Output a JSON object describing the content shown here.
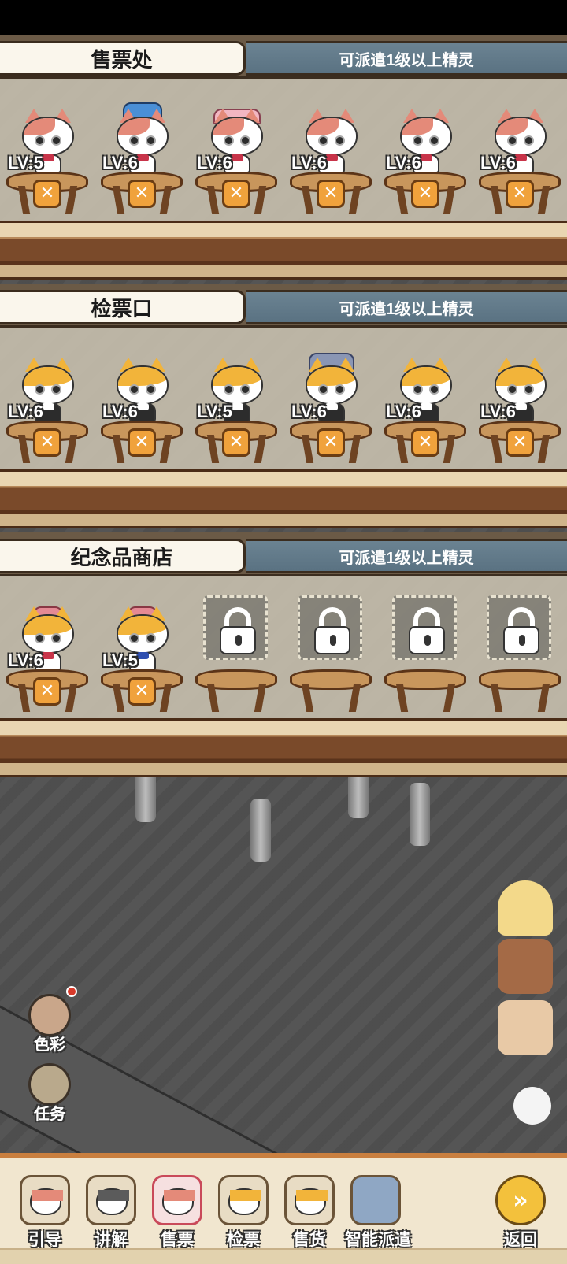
{
  "panels": [
    {
      "title": "售票处",
      "hint": "可派遣1级以上精灵",
      "slots": [
        {
          "level": "LV:5",
          "style": "calico"
        },
        {
          "level": "LV:6",
          "style": "calico"
        },
        {
          "level": "LV:6",
          "style": "calico"
        },
        {
          "level": "LV:6",
          "style": "calico"
        },
        {
          "level": "LV:6",
          "style": "calico"
        },
        {
          "level": "LV:6",
          "style": "calico"
        }
      ]
    },
    {
      "title": "检票口",
      "hint": "可派遣1级以上精灵",
      "slots": [
        {
          "level": "LV:6",
          "style": "yellow"
        },
        {
          "level": "LV:6",
          "style": "yellow"
        },
        {
          "level": "LV:5",
          "style": "yellow"
        },
        {
          "level": "LV:6",
          "style": "yellow"
        },
        {
          "level": "LV:6",
          "style": "yellow"
        },
        {
          "level": "LV:6",
          "style": "yellow"
        }
      ]
    },
    {
      "title": "纪念品商店",
      "hint": "可派遣1级以上精灵",
      "slots": [
        {
          "level": "LV:6",
          "style": "yellow"
        },
        {
          "level": "LV:5",
          "style": "yellow"
        },
        {
          "locked": true
        },
        {
          "locked": true
        },
        {
          "locked": true
        },
        {
          "locked": true
        }
      ]
    }
  ],
  "remove_glyph": "✕",
  "side_buttons": [
    {
      "label": "色彩",
      "icon": "palette-icon"
    },
    {
      "label": "任务",
      "icon": "quest-icon"
    }
  ],
  "bottom_nav": [
    {
      "label": "引导",
      "icon": "guide-cat-icon"
    },
    {
      "label": "讲解",
      "icon": "narrator-cat-icon"
    },
    {
      "label": "售票",
      "icon": "ticket-cat-icon",
      "active": true
    },
    {
      "label": "检票",
      "icon": "check-cat-icon"
    },
    {
      "label": "售货",
      "icon": "shop-cat-icon"
    },
    {
      "label": "智能派遣",
      "icon": "ai-dispatch-icon"
    },
    {
      "label": "返回",
      "icon": "return-icon"
    }
  ],
  "return_glyph": "»",
  "colors": {
    "accent_orange": "#f0a23c",
    "wood": "#7a4a2a",
    "header_blue": "#5a7282",
    "active_nav": "#c94a5a"
  }
}
